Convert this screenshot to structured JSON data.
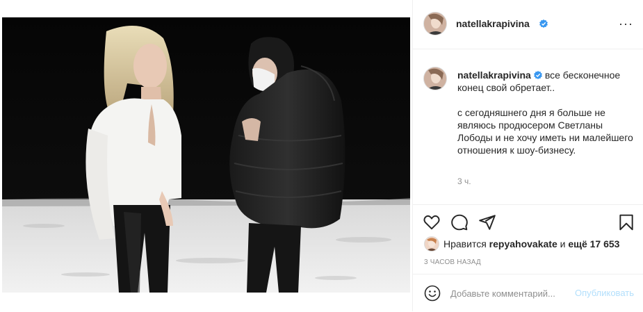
{
  "colors": {
    "accent": "#0095f6",
    "accent_disabled": "#b2dffc",
    "text": "#262626",
    "muted": "#8e8e8e",
    "divider": "#efefef"
  },
  "photo": {
    "scene": "two women in a snowy night field"
  },
  "header": {
    "username": "natellakrapivina",
    "verified_icon": "verified-badge-icon",
    "more_label": "···"
  },
  "caption": {
    "username": "natellakrapivina",
    "first_line": "все бесконечное конец свой обретает..",
    "body": "с сегодняшнего дня я больше не являюсь продюсером Светланы Лободы и не хочу иметь ни малейшего отношения к шоу-бизнесу.",
    "time": "3 ч."
  },
  "actions": {
    "like_icon": "heart-icon",
    "comment_icon": "comment-icon",
    "share_icon": "share-icon",
    "save_icon": "bookmark-icon"
  },
  "likes": {
    "prefix": "Нравится",
    "user": "repyahovakate",
    "middle": "и",
    "rest": "ещё 17 653"
  },
  "posted_ago": "3 часов назад",
  "comment_box": {
    "placeholder": "Добавьте комментарий...",
    "publish_label": "Опубликовать",
    "emoji_icon": "smiley-icon"
  }
}
